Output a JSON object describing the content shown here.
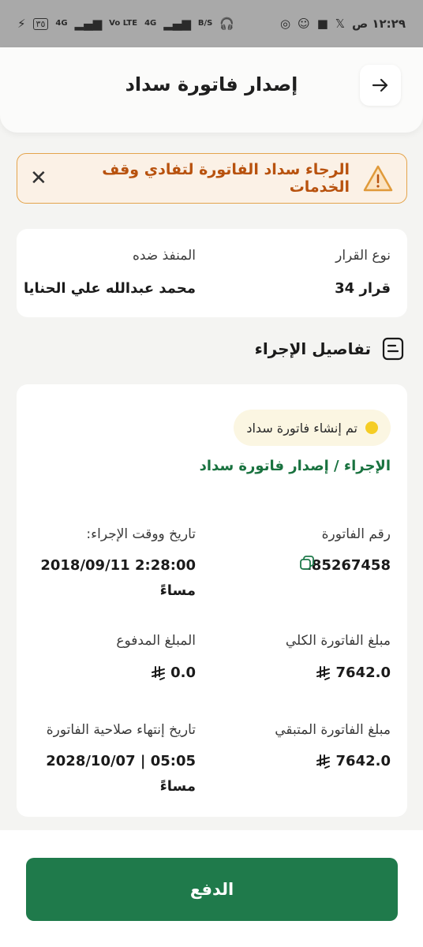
{
  "status_bar": {
    "time": "١٢:٢٩ ص",
    "battery": "٣٥",
    "net1": "4G",
    "net2": "Vo LTE",
    "net3": "4G",
    "speed": "B/S"
  },
  "header": {
    "title": "إصدار فاتورة سداد"
  },
  "alert": {
    "text": "الرجاء سداد الفاتورة لتفادي وقف الخدمات",
    "color": "#b8520e"
  },
  "decision": {
    "type_label": "نوع القرار",
    "type_value": "قرار 34",
    "executed_against_label": "المنفذ ضده",
    "executed_against_value": "محمد عبدالله علي الحنايا"
  },
  "section": {
    "title": "تفاصيل الإجراء"
  },
  "procedure": {
    "status": "تم إنشاء فاتورة سداد",
    "breadcrumb": "الإجراء / إصدار فاتورة سداد",
    "invoice_number_label": "رقم الفاتورة",
    "invoice_number_value": "185267458",
    "datetime_label": "تاريخ ووقت الإجراء:",
    "datetime_value_line1": "2:28:00 2018/09/11",
    "datetime_value_line2": "مساءً",
    "total_label": "مبلغ الفاتورة الكلي",
    "total_value": "7642.0",
    "paid_label": "المبلغ المدفوع",
    "paid_value": "0.0",
    "remaining_label": "مبلغ الفاتورة المتبقي",
    "remaining_value": "7642.0",
    "expiry_label": "تاريخ إنتهاء صلاحية الفاتورة",
    "expiry_value_line1": "05:05 | 2028/10/07",
    "expiry_value_line2": "مساءً"
  },
  "pay_button": {
    "label": "الدفع",
    "color": "#1f7a4b"
  },
  "icons": {
    "back": "arrow-right-icon",
    "warning": "warning-triangle-icon",
    "close": "close-icon",
    "document": "document-icon",
    "copy": "copy-icon",
    "currency": "saudi-riyal-icon"
  }
}
